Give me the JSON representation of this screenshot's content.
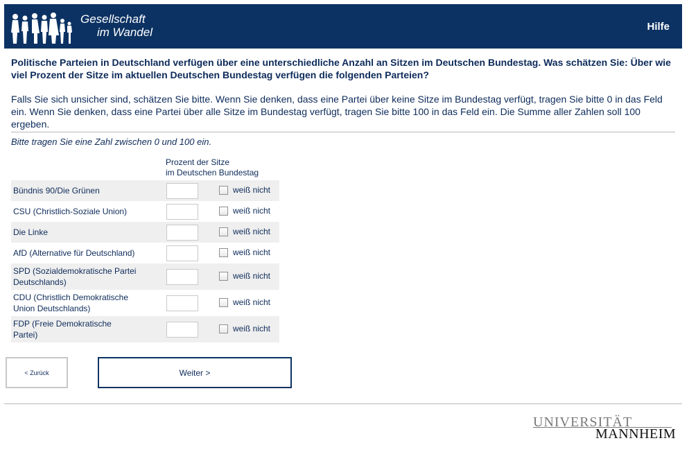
{
  "header": {
    "brand_line1": "Gesellschaft",
    "brand_line2": "im Wandel",
    "help_label": "Hilfe",
    "logo_icon": "people-silhouettes-icon",
    "background_color": "#0c3263"
  },
  "question": {
    "text": "Politische Parteien in Deutschland verfügen über eine unterschiedliche Anzahl an Sitzen im Deutschen Bundestag. Was schätzen Sie: Über wie viel Prozent der Sitze im aktuellen Deutschen Bundestag verfügen die folgenden Parteien?",
    "instruction": "Falls Sie sich unsicher sind, schätzen Sie bitte. Wenn Sie denken, dass eine Partei über keine Sitze im Bundestag verfügt, tragen Sie bitte 0 in das Feld ein. Wenn Sie denken, dass eine Partei über alle Sitze im Bundestag verfügt, tragen Sie bitte 100 in das Feld ein. Die Summe aller Zahlen soll 100 ergeben.",
    "hint": "Bitte tragen Sie eine Zahl zwischen 0 und 100 ein."
  },
  "grid": {
    "column_header_line1": "Prozent der Sitze",
    "column_header_line2": "im Deutschen Bundestag",
    "dont_know_label": "weiß nicht",
    "rows": [
      {
        "label": "Bündnis 90/Die Grünen",
        "value": "",
        "dont_know": false
      },
      {
        "label": "CSU (Christlich-Soziale Union)",
        "value": "",
        "dont_know": false
      },
      {
        "label": "Die Linke",
        "value": "",
        "dont_know": false
      },
      {
        "label": "AfD (Alternative für Deutschland)",
        "value": "",
        "dont_know": false
      },
      {
        "label": "SPD (Sozialdemokratische Partei Deutschlands)",
        "value": "",
        "dont_know": false
      },
      {
        "label": "CDU (Christlich Demokratische Union Deutschlands)",
        "value": "",
        "dont_know": false
      },
      {
        "label": "FDP (Freie Demokratische Partei)",
        "value": "",
        "dont_know": false
      }
    ]
  },
  "nav": {
    "back_label": "< Zurück",
    "next_label": "Weiter >"
  },
  "footer": {
    "logo_line1": "UNIVERSITÄT",
    "logo_line2": "MANNHEIM"
  }
}
